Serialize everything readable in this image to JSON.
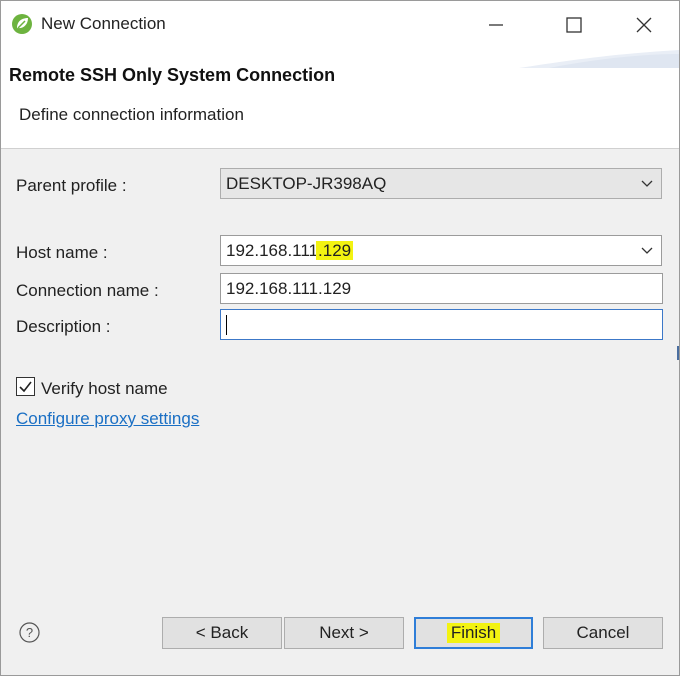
{
  "window": {
    "title": "New Connection",
    "controls": {
      "minimize": "minimize-icon",
      "maximize": "maximize-icon",
      "close": "close-icon"
    }
  },
  "banner": {
    "title": "Remote SSH Only System Connection",
    "subtitle": "Define connection information"
  },
  "form": {
    "parent_profile": {
      "label": "Parent profile :",
      "value": "DESKTOP-JR398AQ"
    },
    "host_name": {
      "label": "Host name :",
      "value_prefix": "192.168.111",
      "value_highlight": ".129"
    },
    "connection_name": {
      "label": "Connection name :",
      "value": "192.168.111.129"
    },
    "description": {
      "label": "Description :",
      "value": ""
    },
    "verify_host": {
      "label": "Verify host name",
      "checked": true
    },
    "proxy_link": "Configure proxy settings"
  },
  "buttons": {
    "back": "< Back",
    "next": "Next >",
    "finish": "Finish",
    "cancel": "Cancel"
  },
  "colors": {
    "highlight": "#f3f311",
    "link": "#1a6fc4",
    "focus": "#3c78c8"
  }
}
